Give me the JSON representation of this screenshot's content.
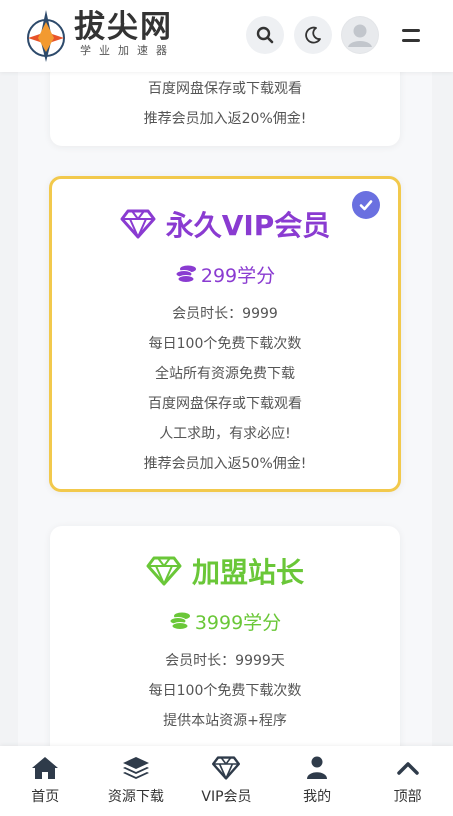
{
  "header": {
    "brand_name": "拔尖网",
    "brand_sub": "学业加速器"
  },
  "cards": [
    {
      "lines": [
        "百度网盘保存或下载观看",
        "推荐会员加入返20%佣金!"
      ]
    },
    {
      "title": "永久VIP会员",
      "price": "299学分",
      "color": "#8a3bd1",
      "selected": true,
      "lines": [
        "会员时长：9999",
        "每日100个免费下载次数",
        "全站所有资源免费下载",
        "百度网盘保存或下载观看",
        "人工求助，有求必应!",
        "推荐会员加入返50%佣金!"
      ]
    },
    {
      "title": "加盟站长",
      "price": "3999学分",
      "color": "#6ac738",
      "lines": [
        "会员时长：9999天",
        "每日100个免费下载次数",
        "提供本站资源+程序"
      ]
    }
  ],
  "tabbar": {
    "items": [
      {
        "label": "首页",
        "icon": "home-icon"
      },
      {
        "label": "资源下载",
        "icon": "layers-icon"
      },
      {
        "label": "VIP会员",
        "icon": "diamond-icon"
      },
      {
        "label": "我的",
        "icon": "user-icon"
      },
      {
        "label": "顶部",
        "icon": "chevron-up-icon"
      }
    ]
  }
}
